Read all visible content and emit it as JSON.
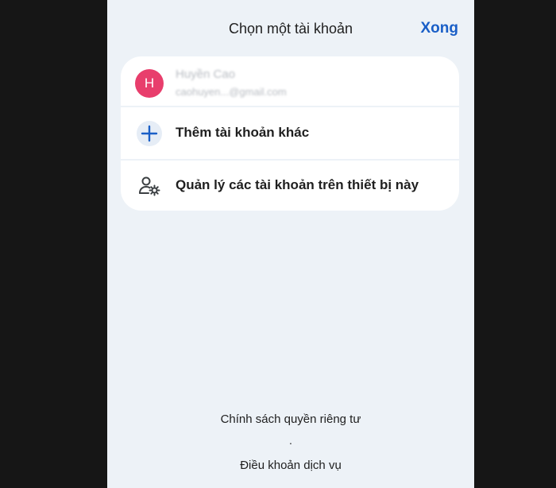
{
  "header": {
    "title": "Chọn một tài khoản",
    "done_label": "Xong"
  },
  "account": {
    "avatar_initial": "H",
    "avatar_color": "#e83e6c",
    "name": "Huyền Cao",
    "email": "caohuyen...@gmail.com"
  },
  "actions": [
    {
      "label": "Thêm tài khoản khác",
      "icon": "plus-icon"
    },
    {
      "label": "Quản lý các tài khoản trên thiết bị này",
      "icon": "manage-accounts-icon"
    }
  ],
  "footer": {
    "privacy_label": "Chính sách quyền riêng tư",
    "separator": ".",
    "terms_label": "Điều khoản dịch vụ"
  },
  "colors": {
    "accent": "#1a5fc7",
    "panel_bg": "#edf2f7",
    "card_bg": "#ffffff",
    "letterbox": "#161616"
  }
}
